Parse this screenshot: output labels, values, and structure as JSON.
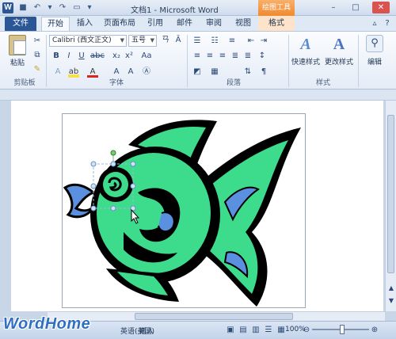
{
  "window": {
    "title": "文档1 - Microsoft Word",
    "context_tab_group": "绘图工具"
  },
  "tabs": [
    "文件",
    "开始",
    "插入",
    "页面布局",
    "引用",
    "邮件",
    "审阅",
    "视图",
    "格式"
  ],
  "ribbon": {
    "clipboard": {
      "paste": "粘贴",
      "label": "剪贴板"
    },
    "font": {
      "name": "Calibri (西文正文)",
      "size": "五号",
      "label": "字体"
    },
    "paragraph": {
      "label": "段落"
    },
    "styles": {
      "quick_styles": "快速样式",
      "change_styles": "更改样式",
      "label": "样式"
    },
    "editing": {
      "label": "编辑"
    }
  },
  "status": {
    "language": "英语(美国)",
    "mode": "插入",
    "zoom": "100%"
  },
  "watermark": "WordHome",
  "colors": {
    "fish_body": "#3ddc8c",
    "fish_outline": "#000000",
    "fish_fin_blue": "#5b8fe0",
    "selection_handle": "#7fb2e8"
  }
}
